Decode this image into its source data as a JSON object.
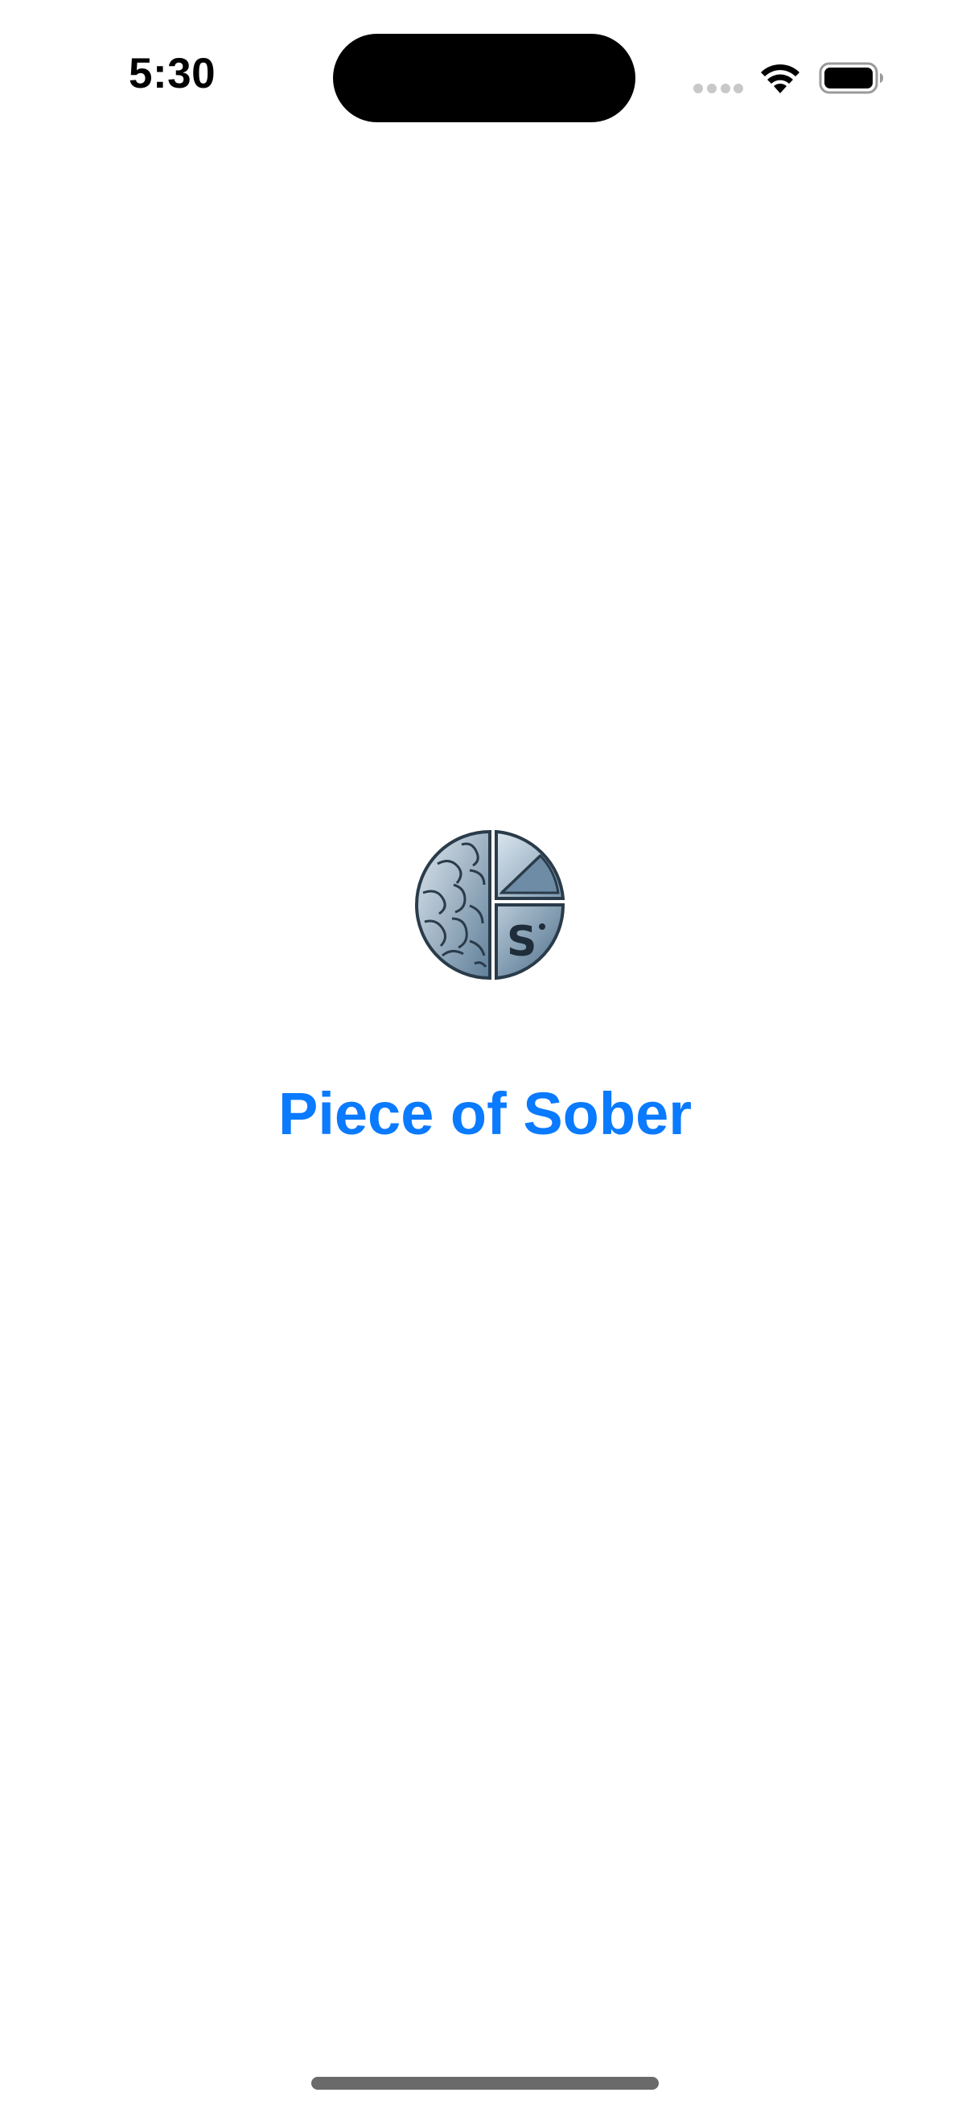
{
  "status_bar": {
    "time": "5:30",
    "icons": [
      "cellular-signal-icon",
      "wifi-icon",
      "battery-icon"
    ]
  },
  "splash": {
    "logo_icon": "brain-chart-logo-icon",
    "app_name": "Piece of Sober"
  },
  "colors": {
    "accent": "#0a7aff",
    "background": "#ffffff",
    "logo_primary": "#5c7d98",
    "logo_light": "#c9d6e0"
  }
}
